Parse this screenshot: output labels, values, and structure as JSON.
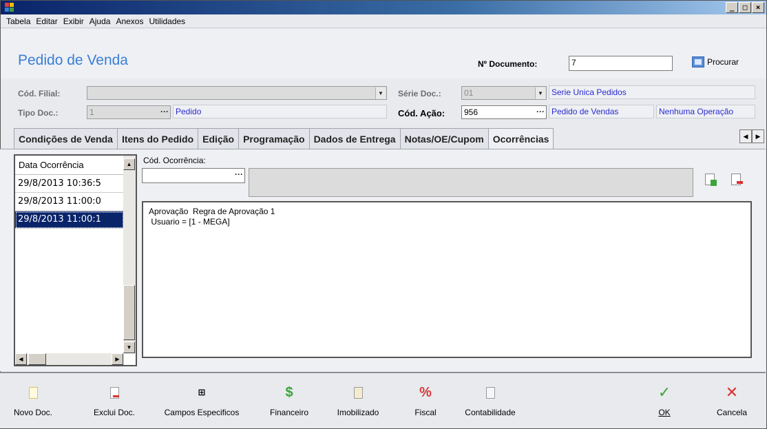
{
  "window": {
    "buttons": {
      "minimize": "_",
      "maximize": "□",
      "close": "×"
    }
  },
  "menu": [
    "Tabela",
    "Editar",
    "Exibir",
    "Ajuda",
    "Anexos",
    "Utilidades"
  ],
  "header": {
    "title": "Pedido de Venda",
    "doc_label": "Nº Documento:",
    "doc_value": "7",
    "search_label": "Procurar"
  },
  "form": {
    "filial_label": "Cód. Filial:",
    "filial_value": "",
    "serie_label": "Série Doc.:",
    "serie_value": "01",
    "serie_desc": "Serie Unica Pedidos",
    "tipo_label": "Tipo Doc.:",
    "tipo_value": "1",
    "tipo_desc": "Pedido",
    "acao_label": "Cód. Ação:",
    "acao_value": "956",
    "acao_desc": "Pedido de Vendas",
    "acao_extra": "Nenhuma Operação"
  },
  "tabs": [
    "Condições de Venda",
    "Itens do Pedido",
    "Edição",
    "Programação",
    "Dados de Entrega",
    "Notas/OE/Cupom",
    "Ocorrências"
  ],
  "active_tab": "Ocorrências",
  "occurrences": {
    "column_header": "Data Ocorrência",
    "rows": [
      "29/8/2013 10:36:5",
      "29/8/2013 11:00:0",
      "29/8/2013 11:00:1"
    ],
    "code_label": "Cód. Ocorrência:",
    "code_value": "",
    "memo_line1": "Aprovação  Regra de Aprovação 1",
    "memo_line2": " Usuario = [1 - MEGA]"
  },
  "footer": {
    "novo": "Novo Doc.",
    "exclui": "Exclui Doc.",
    "campos": "Campos Especificos",
    "financeiro": "Financeiro",
    "imobilizado": "Imobilizado",
    "fiscal": "Fiscal",
    "contabilidade": "Contabilidade",
    "ok": "OK",
    "cancela": "Cancela"
  },
  "colors": {
    "title_blue": "#3a7dd6",
    "desc_blue": "#2a2ad0",
    "selection": "#0a246a",
    "ok_green": "#3aa53a",
    "cancel_red": "#d93030",
    "fiscal_red": "#d43a3a"
  }
}
